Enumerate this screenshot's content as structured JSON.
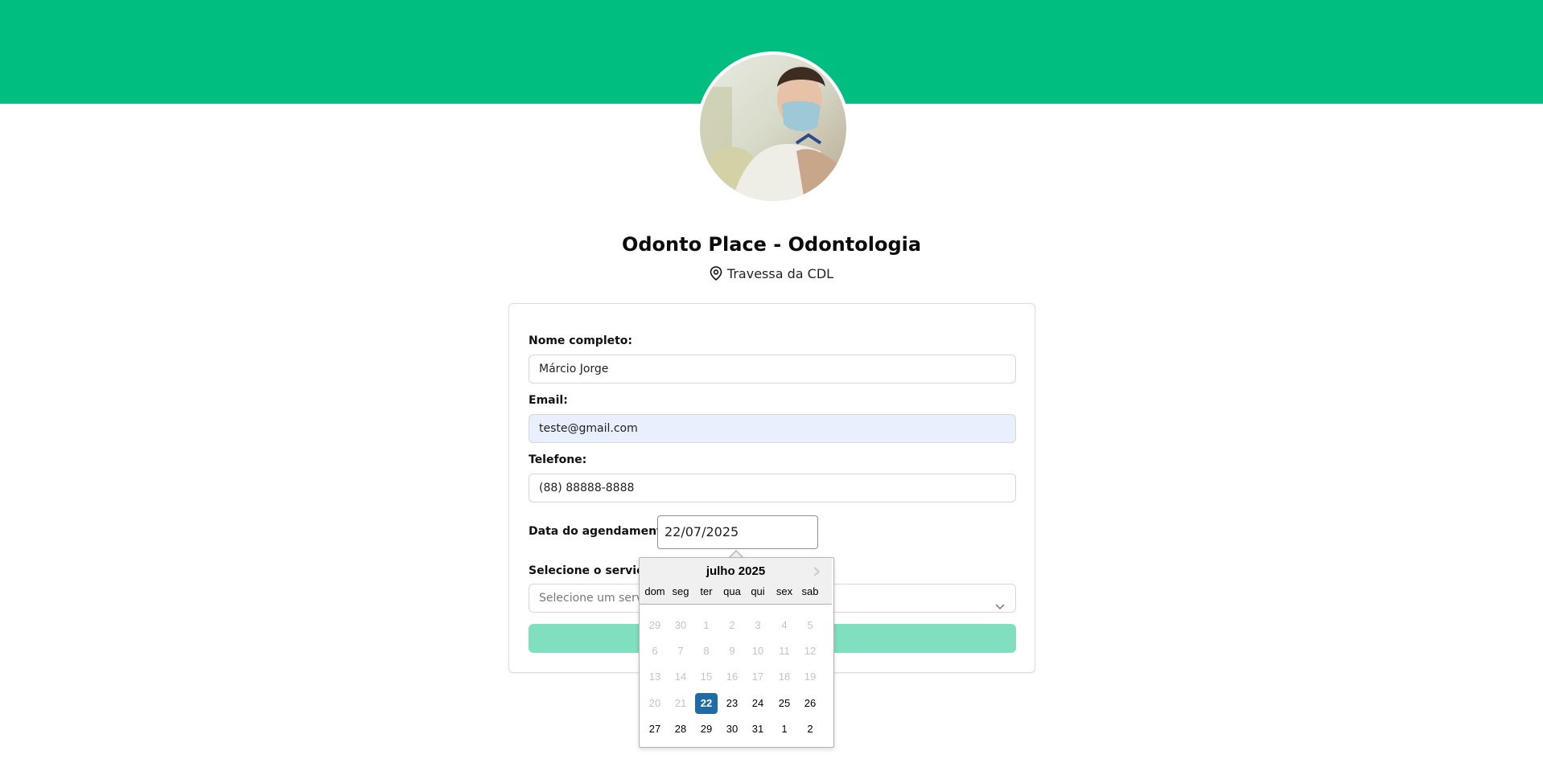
{
  "header": {
    "brand_color": "#00be7f",
    "avatar_alt": "dentist-photo"
  },
  "business": {
    "name": "Odonto Place - Odontologia",
    "address": "Travessa da CDL"
  },
  "form": {
    "name_label": "Nome completo:",
    "name_value": "Márcio Jorge",
    "email_label": "Email:",
    "email_value": "teste@gmail.com",
    "phone_label": "Telefone:",
    "phone_value": "(88) 88888-8888",
    "date_label": "Data do agendamento:",
    "date_value": "22/07/2025",
    "service_label": "Selecione o serviço:",
    "service_placeholder": "Selecione um serviço"
  },
  "calendar": {
    "month_label": "julho 2025",
    "weekdays": [
      "dom",
      "seg",
      "ter",
      "qua",
      "qui",
      "sex",
      "sab"
    ],
    "weeks": [
      [
        "29",
        "30",
        "1",
        "2",
        "3",
        "4",
        "5"
      ],
      [
        "6",
        "7",
        "8",
        "9",
        "10",
        "11",
        "12"
      ],
      [
        "13",
        "14",
        "15",
        "16",
        "17",
        "18",
        "19"
      ],
      [
        "20",
        "21",
        "22",
        "23",
        "24",
        "25",
        "26"
      ],
      [
        "27",
        "28",
        "29",
        "30",
        "31",
        "1",
        "2"
      ]
    ],
    "selected_day": "22",
    "selected_color": "#216ba5"
  }
}
